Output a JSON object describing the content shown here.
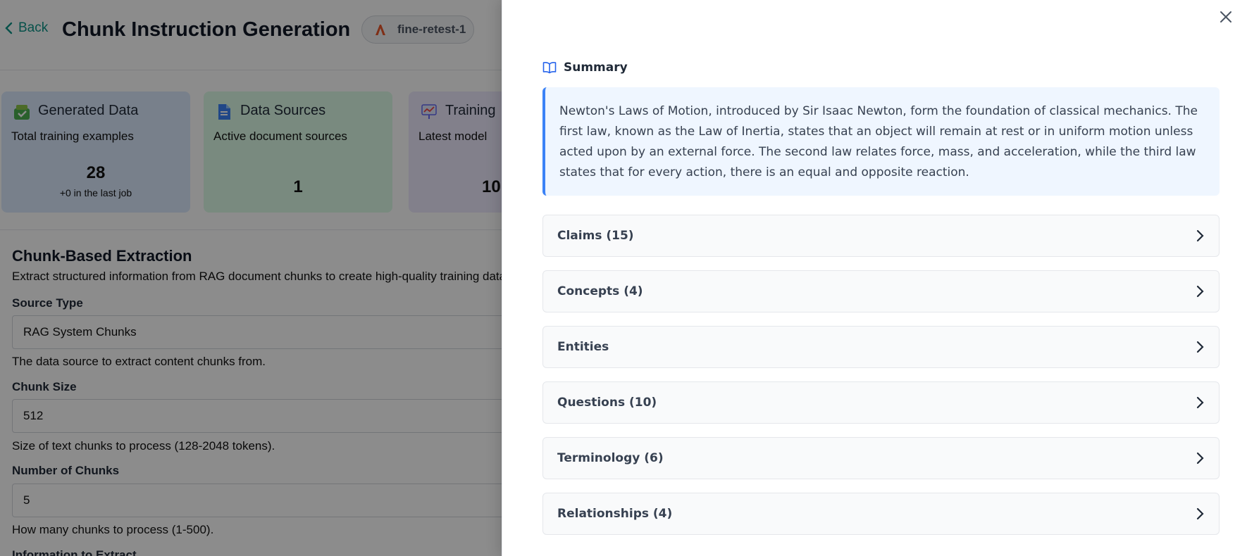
{
  "background": {
    "back_label": "Back",
    "title": "Chunk Instruction Generation",
    "model_badge": "fine-retest-1",
    "cards": [
      {
        "title": "Generated Data",
        "subtitle": "Total training examples",
        "value": "28",
        "note": "+0 in the last job"
      },
      {
        "title": "Data Sources",
        "subtitle": "Active document sources",
        "value": "1"
      },
      {
        "title": "Training",
        "subtitle": "Latest model",
        "value": "10"
      }
    ],
    "section": {
      "title": "Chunk-Based Extraction",
      "description": "Extract structured information from RAG document chunks to create high-quality training data.",
      "fields": [
        {
          "label": "Source Type",
          "value": "RAG System Chunks",
          "help": "The data source to extract content chunks from."
        },
        {
          "label": "Chunk Size",
          "value": "512",
          "help": "Size of text chunks to process (128-2048 tokens)."
        },
        {
          "label": "Number of Chunks",
          "value": "5",
          "help": "How many chunks to process (1-500)."
        }
      ],
      "next_label": "Information to Extract"
    }
  },
  "drawer": {
    "summary_label": "Summary",
    "summary_text": "Newton's Laws of Motion, introduced by Sir Isaac Newton, form the foundation of classical mechanics. The first law, known as the Law of Inertia, states that an object will remain at rest or in uniform motion unless acted upon by an external force. The second law relates force, mass, and acceleration, while the third law states that for every action, there is an equal and opposite reaction.",
    "sections": [
      {
        "label": "Claims (15)"
      },
      {
        "label": "Concepts (4)"
      },
      {
        "label": "Entities"
      },
      {
        "label": "Questions (10)"
      },
      {
        "label": "Terminology (6)"
      },
      {
        "label": "Relationships (4)"
      }
    ]
  },
  "colors": {
    "accent": "#0d9488",
    "summary_bg": "#eff6ff",
    "summary_border": "#3b82f6"
  }
}
